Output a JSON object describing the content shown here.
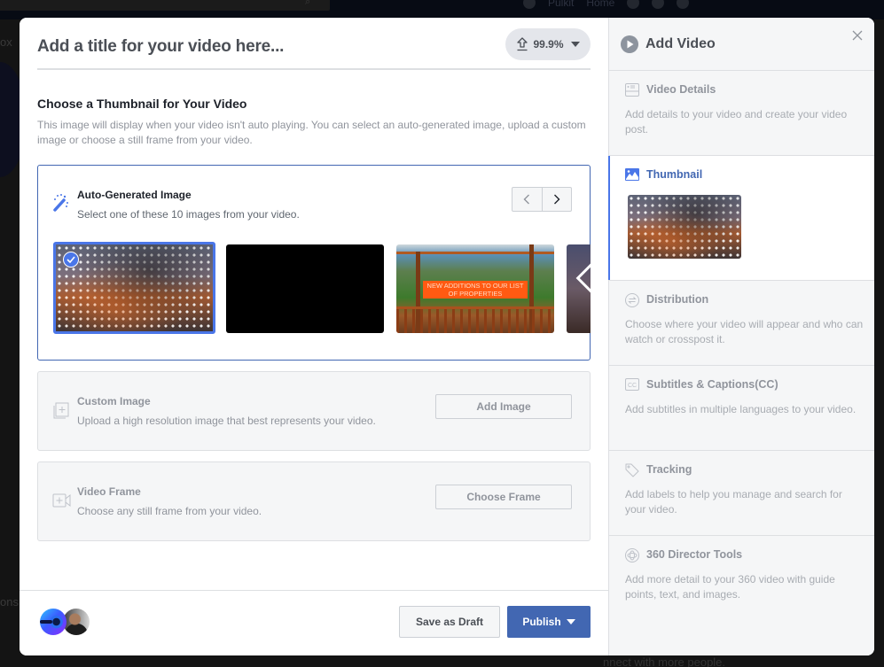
{
  "background": {
    "nav_user": "Pulkit",
    "nav_home": "Home",
    "side_text_top": "ox",
    "side_text_bottom": "ons",
    "bottom_text": "nnect with more people."
  },
  "main": {
    "title_placeholder": "Add a title for your video here...",
    "upload_progress": "99.9%",
    "thumbnail_section": {
      "title": "Choose a Thumbnail for Your Video",
      "description": "This image will display when your video isn't auto playing. You can select an auto-generated image, upload a custom image or choose a still frame from your video."
    },
    "auto_generated": {
      "title": "Auto-Generated Image",
      "subtitle": "Select one of these 10 images from your video.",
      "image_count": 10,
      "selected_index": 0,
      "prev_label": "‹",
      "next_label": "›",
      "thumbnails": [
        {
          "label": "thumbnail-1",
          "selected": true
        },
        {
          "label": "thumbnail-2",
          "selected": false
        },
        {
          "label": "thumbnail-3",
          "selected": false,
          "overlay_text": "NEW ADDITIONS TO OUR LIST OF PROPERTIES"
        },
        {
          "label": "thumbnail-4",
          "selected": false
        }
      ]
    },
    "custom_image": {
      "title": "Custom Image",
      "subtitle": "Upload a high resolution image that best represents your video.",
      "button": "Add Image"
    },
    "video_frame": {
      "title": "Video Frame",
      "subtitle": "Choose any still frame from your video.",
      "button": "Choose Frame"
    },
    "footer": {
      "save_draft": "Save as Draft",
      "publish": "Publish"
    }
  },
  "side": {
    "title": "Add Video",
    "steps": [
      {
        "icon": "details-icon",
        "title": "Video Details",
        "desc": "Add details to your video and create your video post.",
        "active": false
      },
      {
        "icon": "image-icon",
        "title": "Thumbnail",
        "desc": "",
        "active": true
      },
      {
        "icon": "distribution-icon",
        "title": "Distribution",
        "desc": "Choose where your video will appear and who can watch or crosspost it.",
        "active": false
      },
      {
        "icon": "cc-icon",
        "title": "Subtitles & Captions(CC)",
        "desc": "Add subtitles in multiple languages to your video.",
        "active": false
      },
      {
        "icon": "tag-icon",
        "title": "Tracking",
        "desc": "Add labels to help you manage and search for your video.",
        "active": false
      },
      {
        "icon": "360-icon",
        "title": "360 Director Tools",
        "desc": "Add more detail to your 360 video with guide points, text, and images.",
        "active": false
      }
    ]
  },
  "colors": {
    "accent": "#4267b2",
    "selection": "#4a76e8",
    "thumbnail_banner": "#ff5a12"
  }
}
